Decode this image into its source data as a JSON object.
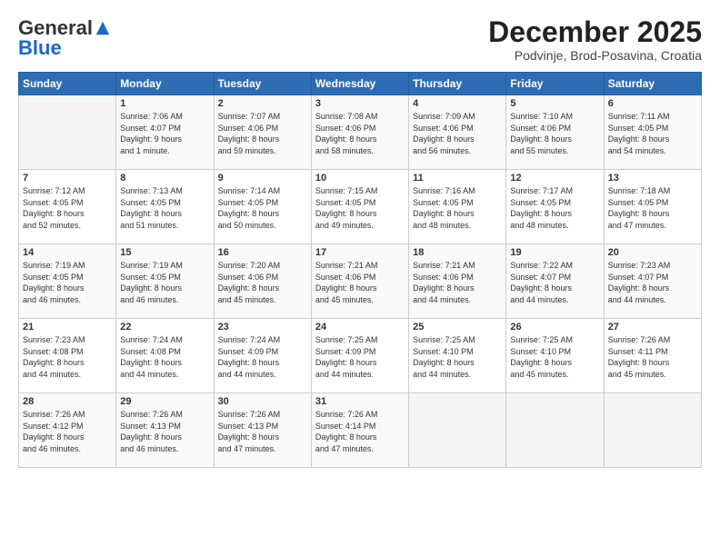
{
  "logo": {
    "general": "General",
    "blue": "Blue"
  },
  "title": "December 2025",
  "subtitle": "Podvinje, Brod-Posavina, Croatia",
  "days_header": [
    "Sunday",
    "Monday",
    "Tuesday",
    "Wednesday",
    "Thursday",
    "Friday",
    "Saturday"
  ],
  "weeks": [
    [
      {
        "day": "",
        "info": ""
      },
      {
        "day": "1",
        "info": "Sunrise: 7:06 AM\nSunset: 4:07 PM\nDaylight: 9 hours\nand 1 minute."
      },
      {
        "day": "2",
        "info": "Sunrise: 7:07 AM\nSunset: 4:06 PM\nDaylight: 8 hours\nand 59 minutes."
      },
      {
        "day": "3",
        "info": "Sunrise: 7:08 AM\nSunset: 4:06 PM\nDaylight: 8 hours\nand 58 minutes."
      },
      {
        "day": "4",
        "info": "Sunrise: 7:09 AM\nSunset: 4:06 PM\nDaylight: 8 hours\nand 56 minutes."
      },
      {
        "day": "5",
        "info": "Sunrise: 7:10 AM\nSunset: 4:06 PM\nDaylight: 8 hours\nand 55 minutes."
      },
      {
        "day": "6",
        "info": "Sunrise: 7:11 AM\nSunset: 4:05 PM\nDaylight: 8 hours\nand 54 minutes."
      }
    ],
    [
      {
        "day": "7",
        "info": "Sunrise: 7:12 AM\nSunset: 4:05 PM\nDaylight: 8 hours\nand 52 minutes."
      },
      {
        "day": "8",
        "info": "Sunrise: 7:13 AM\nSunset: 4:05 PM\nDaylight: 8 hours\nand 51 minutes."
      },
      {
        "day": "9",
        "info": "Sunrise: 7:14 AM\nSunset: 4:05 PM\nDaylight: 8 hours\nand 50 minutes."
      },
      {
        "day": "10",
        "info": "Sunrise: 7:15 AM\nSunset: 4:05 PM\nDaylight: 8 hours\nand 49 minutes."
      },
      {
        "day": "11",
        "info": "Sunrise: 7:16 AM\nSunset: 4:05 PM\nDaylight: 8 hours\nand 48 minutes."
      },
      {
        "day": "12",
        "info": "Sunrise: 7:17 AM\nSunset: 4:05 PM\nDaylight: 8 hours\nand 48 minutes."
      },
      {
        "day": "13",
        "info": "Sunrise: 7:18 AM\nSunset: 4:05 PM\nDaylight: 8 hours\nand 47 minutes."
      }
    ],
    [
      {
        "day": "14",
        "info": "Sunrise: 7:19 AM\nSunset: 4:05 PM\nDaylight: 8 hours\nand 46 minutes."
      },
      {
        "day": "15",
        "info": "Sunrise: 7:19 AM\nSunset: 4:05 PM\nDaylight: 8 hours\nand 46 minutes."
      },
      {
        "day": "16",
        "info": "Sunrise: 7:20 AM\nSunset: 4:06 PM\nDaylight: 8 hours\nand 45 minutes."
      },
      {
        "day": "17",
        "info": "Sunrise: 7:21 AM\nSunset: 4:06 PM\nDaylight: 8 hours\nand 45 minutes."
      },
      {
        "day": "18",
        "info": "Sunrise: 7:21 AM\nSunset: 4:06 PM\nDaylight: 8 hours\nand 44 minutes."
      },
      {
        "day": "19",
        "info": "Sunrise: 7:22 AM\nSunset: 4:07 PM\nDaylight: 8 hours\nand 44 minutes."
      },
      {
        "day": "20",
        "info": "Sunrise: 7:23 AM\nSunset: 4:07 PM\nDaylight: 8 hours\nand 44 minutes."
      }
    ],
    [
      {
        "day": "21",
        "info": "Sunrise: 7:23 AM\nSunset: 4:08 PM\nDaylight: 8 hours\nand 44 minutes."
      },
      {
        "day": "22",
        "info": "Sunrise: 7:24 AM\nSunset: 4:08 PM\nDaylight: 8 hours\nand 44 minutes."
      },
      {
        "day": "23",
        "info": "Sunrise: 7:24 AM\nSunset: 4:09 PM\nDaylight: 8 hours\nand 44 minutes."
      },
      {
        "day": "24",
        "info": "Sunrise: 7:25 AM\nSunset: 4:09 PM\nDaylight: 8 hours\nand 44 minutes."
      },
      {
        "day": "25",
        "info": "Sunrise: 7:25 AM\nSunset: 4:10 PM\nDaylight: 8 hours\nand 44 minutes."
      },
      {
        "day": "26",
        "info": "Sunrise: 7:25 AM\nSunset: 4:10 PM\nDaylight: 8 hours\nand 45 minutes."
      },
      {
        "day": "27",
        "info": "Sunrise: 7:26 AM\nSunset: 4:11 PM\nDaylight: 8 hours\nand 45 minutes."
      }
    ],
    [
      {
        "day": "28",
        "info": "Sunrise: 7:26 AM\nSunset: 4:12 PM\nDaylight: 8 hours\nand 46 minutes."
      },
      {
        "day": "29",
        "info": "Sunrise: 7:26 AM\nSunset: 4:13 PM\nDaylight: 8 hours\nand 46 minutes."
      },
      {
        "day": "30",
        "info": "Sunrise: 7:26 AM\nSunset: 4:13 PM\nDaylight: 8 hours\nand 47 minutes."
      },
      {
        "day": "31",
        "info": "Sunrise: 7:26 AM\nSunset: 4:14 PM\nDaylight: 8 hours\nand 47 minutes."
      },
      {
        "day": "",
        "info": ""
      },
      {
        "day": "",
        "info": ""
      },
      {
        "day": "",
        "info": ""
      }
    ]
  ]
}
